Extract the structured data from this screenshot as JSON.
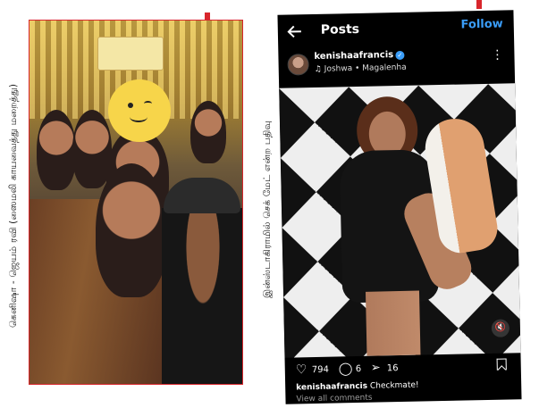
{
  "left_caption": "கெனிஷா - ஜெயம் ரவி (ஸைமலி காயவைத்து மறைத்து)",
  "right_caption": "இன்ஸ்டாகிராமில் செக் மேட் என்ற பதிவு",
  "instagram": {
    "title": "Posts",
    "follow_label": "Follow",
    "username": "kenishaafrancis",
    "music": "Joshwa • Magalenha",
    "likes": "794",
    "comments": "6",
    "shares": "16",
    "caption_user": "kenishaafrancis",
    "caption_text": "Checkmate!",
    "view_comments": "View all comments"
  },
  "icons": [
    "back-arrow-icon",
    "verified-icon",
    "music-note-icon",
    "more-icon",
    "mute-icon",
    "heart-icon",
    "comment-icon",
    "share-icon",
    "bookmark-icon"
  ],
  "colors": {
    "accent_blue": "#3a9df8",
    "frame_red": "#d8262c"
  }
}
